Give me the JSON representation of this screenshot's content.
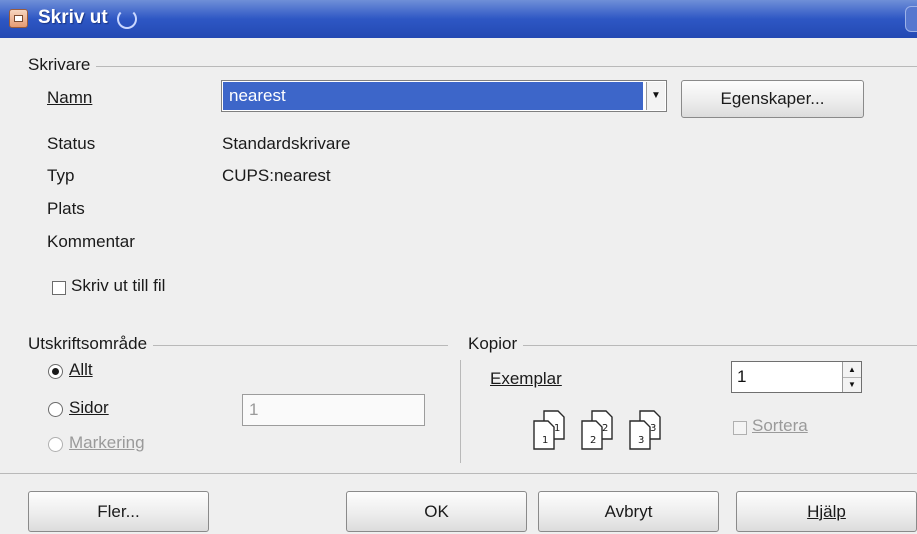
{
  "window": {
    "title": "Skriv ut"
  },
  "printer": {
    "frame_label": "Skrivare",
    "name_label": "Namn",
    "name_value": "nearest",
    "properties_button": "Egenskaper...",
    "status_label": "Status",
    "status_value": "Standardskrivare",
    "type_label": "Typ",
    "type_value": "CUPS:nearest",
    "location_label": "Plats",
    "comment_label": "Kommentar",
    "print_to_file_label": "Skriv ut till fil"
  },
  "print_range": {
    "frame_label": "Utskriftsområde",
    "all_label": "Allt",
    "pages_label": "Sidor",
    "pages_value": "1",
    "selection_label": "Markering"
  },
  "copies": {
    "frame_label": "Kopior",
    "count_label": "Exemplar",
    "count_value": "1",
    "collate_label": "Sortera",
    "page_icons": [
      "1",
      "1",
      "2",
      "2",
      "3",
      "3"
    ]
  },
  "buttons": {
    "more": "Fler...",
    "ok": "OK",
    "cancel": "Avbryt",
    "help": "Hjälp"
  },
  "colors": {
    "titlebar": "#2e57c4",
    "selection": "#3d66c9",
    "dialog_bg": "#efefef"
  }
}
